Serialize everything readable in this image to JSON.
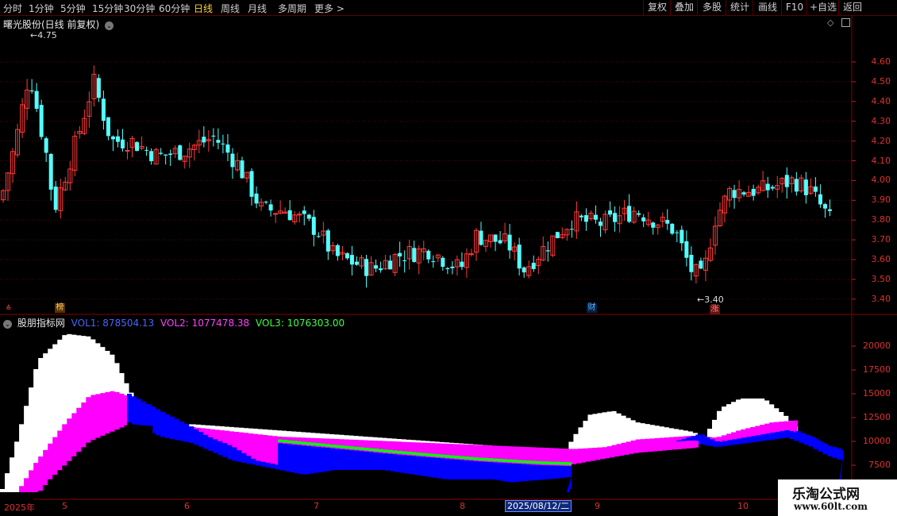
{
  "toolbar": {
    "periods": [
      "分时",
      "1分钟",
      "5分钟",
      "15分钟",
      "30分钟",
      "60分钟",
      "日线",
      "周线",
      "月线",
      "多周期",
      "更多 >"
    ],
    "active": "日线",
    "right": [
      "复权",
      "叠加",
      "多股",
      "统计",
      "画线",
      "F10",
      "+自选",
      "返回"
    ]
  },
  "price_panel": {
    "title": "曙光股份(日线 前复权)",
    "high_label": "4.75",
    "low_label": "3.40",
    "y_ticks": [
      "4.60",
      "4.50",
      "4.40",
      "4.30",
      "4.20",
      "4.10",
      "4.00",
      "3.90",
      "3.80",
      "3.70",
      "3.60",
      "3.50",
      "3.40"
    ],
    "badges": [
      {
        "text": "榜",
        "color": "#ffcc66"
      },
      {
        "text": "财",
        "color": "#66aaff"
      },
      {
        "text": "涨",
        "color": "#ff8080"
      }
    ]
  },
  "volume_panel": {
    "indicator": "股朋指标网",
    "vol1": "VOL1: 878504.13",
    "vol2": "VOL2: 1077478.38",
    "vol3": "VOL3: 1076303.00",
    "y_ticks": [
      "20000",
      "17500",
      "15000",
      "12500",
      "10000",
      "7500"
    ]
  },
  "x_axis": {
    "labels": [
      "2025年",
      "5",
      "6",
      "7",
      "8",
      "9",
      "10"
    ],
    "cursor_date": "2025/08/12/二"
  },
  "watermark": {
    "line1": "乐淘公式网",
    "line2": "www.60lt.com"
  },
  "colors": {
    "up": "#ff3a3a",
    "down": "#54ffff",
    "vol1": "#0000ff",
    "vol2": "#ff00ff",
    "vol3": "#00ff00",
    "white": "#ffffff",
    "red_text": "#e03030"
  }
}
